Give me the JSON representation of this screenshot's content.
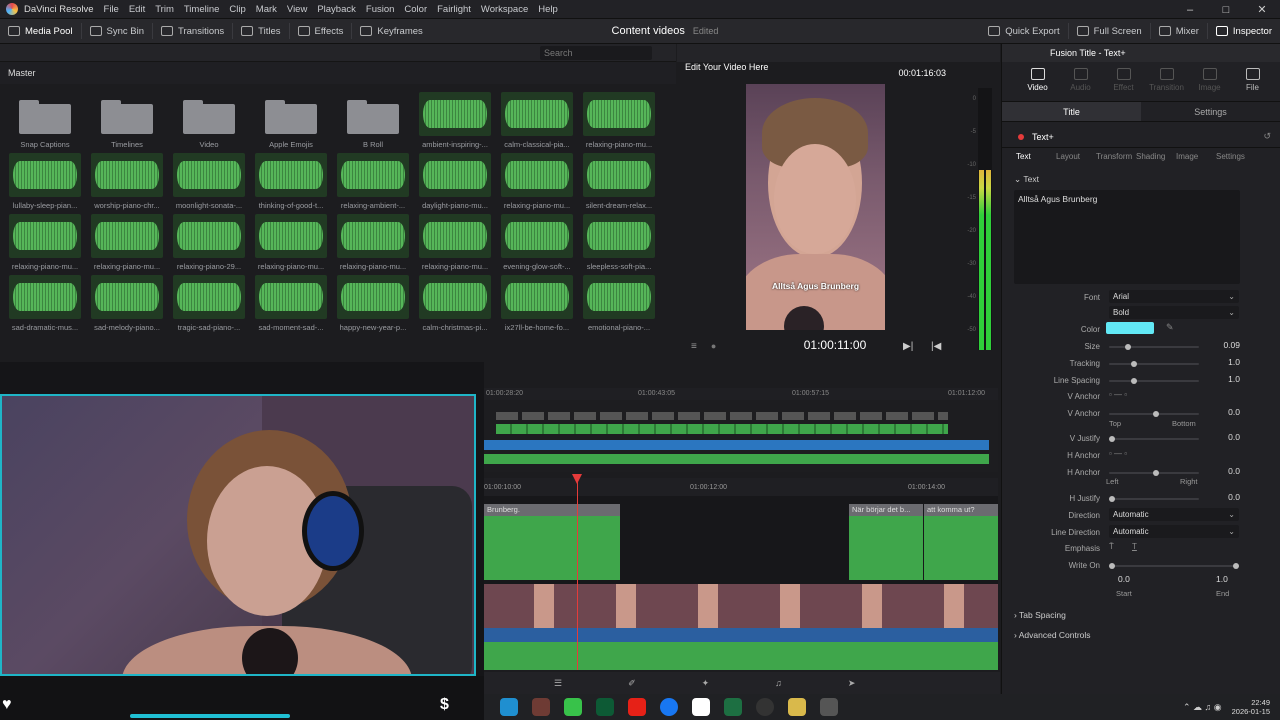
{
  "menubar": {
    "app": "DaVinci Resolve",
    "items": [
      "File",
      "Edit",
      "Trim",
      "Timeline",
      "Clip",
      "Mark",
      "View",
      "Playback",
      "Fusion",
      "Color",
      "Fairlight",
      "Workspace",
      "Help"
    ]
  },
  "toolbar": {
    "left": [
      "Media Pool",
      "Sync Bin",
      "Transitions",
      "Titles",
      "Effects",
      "Keyframes"
    ],
    "project": "Content videos",
    "project_status": "Edited",
    "right": [
      "Quick Export",
      "Full Screen",
      "Mixer",
      "Inspector"
    ]
  },
  "media_pool": {
    "bin": "Master",
    "search_placeholder": "Search",
    "clips": [
      {
        "name": "Snap Captions",
        "kind": "folder"
      },
      {
        "name": "Timelines",
        "kind": "folder"
      },
      {
        "name": "Video",
        "kind": "folder"
      },
      {
        "name": "Apple Emojis",
        "kind": "folder"
      },
      {
        "name": "B Roll",
        "kind": "folder"
      },
      {
        "name": "ambient-inspiring-...",
        "kind": "audio"
      },
      {
        "name": "calm-classical-pia...",
        "kind": "audio"
      },
      {
        "name": "relaxing-piano-mu...",
        "kind": "audio"
      },
      {
        "name": "lullaby-sleep-pian...",
        "kind": "audio"
      },
      {
        "name": "worship-piano-chr...",
        "kind": "audio"
      },
      {
        "name": "moonlight-sonata-...",
        "kind": "audio"
      },
      {
        "name": "thinking-of-good-t...",
        "kind": "audio"
      },
      {
        "name": "relaxing-ambient-...",
        "kind": "audio"
      },
      {
        "name": "daylight-piano-mu...",
        "kind": "audio"
      },
      {
        "name": "relaxing-piano-mu...",
        "kind": "audio"
      },
      {
        "name": "silent-dream-relax...",
        "kind": "audio"
      },
      {
        "name": "relaxing-piano-mu...",
        "kind": "audio"
      },
      {
        "name": "relaxing-piano-mu...",
        "kind": "audio"
      },
      {
        "name": "relaxing-piano-29...",
        "kind": "audio"
      },
      {
        "name": "relaxing-piano-mu...",
        "kind": "audio"
      },
      {
        "name": "relaxing-piano-mu...",
        "kind": "audio"
      },
      {
        "name": "relaxing-piano-mu...",
        "kind": "audio"
      },
      {
        "name": "evening-glow-soft-...",
        "kind": "audio"
      },
      {
        "name": "sleepless-soft-pia...",
        "kind": "audio"
      },
      {
        "name": "sad-dramatic-mus...",
        "kind": "audio"
      },
      {
        "name": "sad-melody-piano...",
        "kind": "audio"
      },
      {
        "name": "tragic-sad-piano-...",
        "kind": "audio"
      },
      {
        "name": "sad-moment-sad-...",
        "kind": "audio"
      },
      {
        "name": "happy-new-year-p...",
        "kind": "audio"
      },
      {
        "name": "calm-christmas-pi...",
        "kind": "audio"
      },
      {
        "name": "ix27ll-be-home-fo...",
        "kind": "audio"
      },
      {
        "name": "emotional-piano-...",
        "kind": "audio"
      }
    ]
  },
  "viewer": {
    "title": "Edit Your Video Here",
    "duration": "00:01:16:03",
    "timecode": "01:00:11:00",
    "caption": "Alltså Agus Brunberg",
    "meter_scale": [
      "0",
      "-5",
      "-10",
      "-15",
      "-20",
      "-30",
      "-40",
      "-50"
    ]
  },
  "timeline": {
    "ruler_top": [
      "01:00:28:20",
      "01:00:43:05",
      "01:00:57:15",
      "01:01:12:00"
    ],
    "ruler_zoom": [
      "01:00:10:00",
      "01:00:12:00",
      "01:00:14:00"
    ],
    "title_clips": [
      "Brunberg.",
      "När börjar det b...",
      "att komma ut?"
    ]
  },
  "inspector": {
    "header": "Fusion Title - Text+",
    "tabs": [
      "Video",
      "Audio",
      "Effect",
      "Transition",
      "Image",
      "File"
    ],
    "subtabs": [
      "Title",
      "Settings"
    ],
    "node": "Text+",
    "node_tabs": [
      "Text",
      "Layout",
      "Transform",
      "Shading",
      "Image",
      "Settings"
    ],
    "section_text": "Text",
    "text_value": "Alltså Agus Brunberg",
    "font_label": "Font",
    "font": "Arial",
    "style": "Bold",
    "color_label": "Color",
    "color_value": "#62e8f5",
    "size_label": "Size",
    "size": "0.09",
    "tracking_label": "Tracking",
    "tracking": "1.0",
    "line_spacing_label": "Line Spacing",
    "line_spacing": "1.0",
    "v_anchor_label": "V Anchor",
    "v_anchor2_label": "V Anchor",
    "v_anchor": "0.0",
    "v_anchor_top": "Top",
    "v_anchor_bottom": "Bottom",
    "v_justify_label": "V Justify",
    "v_justify": "0.0",
    "h_anchor_label": "H Anchor",
    "h_anchor2_label": "H Anchor",
    "h_anchor": "0.0",
    "h_anchor_left": "Left",
    "h_anchor_right": "Right",
    "h_justify_label": "H Justify",
    "h_justify": "0.0",
    "direction_label": "Direction",
    "direction": "Automatic",
    "line_direction_label": "Line Direction",
    "line_direction": "Automatic",
    "emphasis_label": "Emphasis",
    "write_on_label": "Write On",
    "write_on_start": "0.0",
    "write_on_end": "1.0",
    "start_label": "Start",
    "end_label": "End",
    "tab_spacing": "Tab Spacing",
    "advanced": "Advanced Controls"
  },
  "taskbar": {
    "time": "22:49",
    "date": "2026-01-15"
  }
}
